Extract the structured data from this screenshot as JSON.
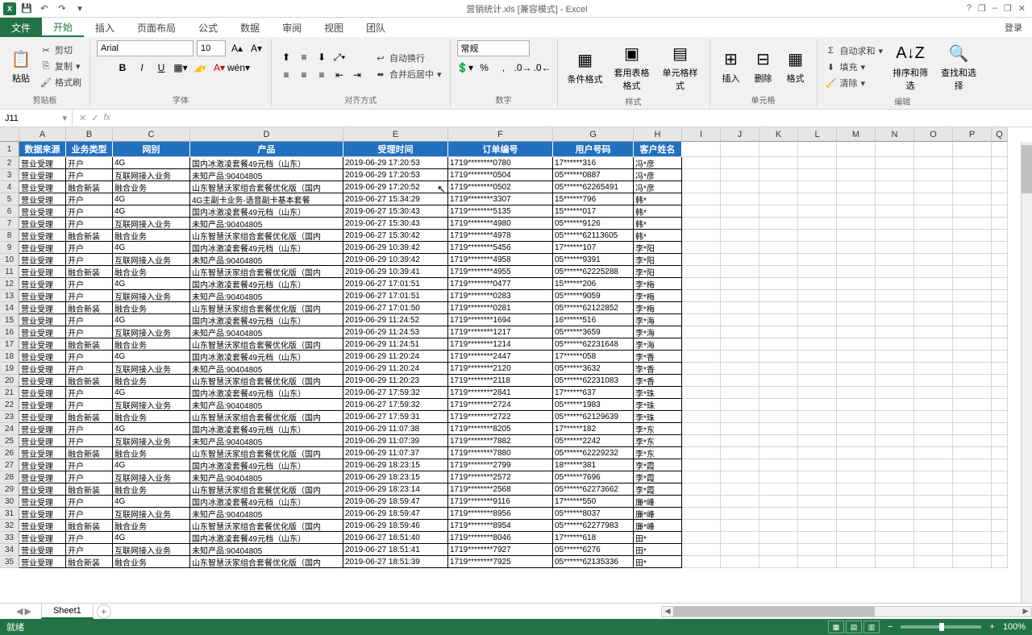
{
  "title": "营销统计.xls [兼容模式] - Excel",
  "qa": {
    "save": "💾",
    "undo": "↶",
    "redo": "↷"
  },
  "window": {
    "help": "?",
    "min": "▁",
    "restore": "❐",
    "max": "–",
    "close": "✕"
  },
  "tabs": {
    "file": "文件",
    "home": "开始",
    "insert": "插入",
    "layout": "页面布局",
    "formulas": "公式",
    "data": "数据",
    "review": "审阅",
    "view": "视图",
    "team": "团队"
  },
  "signin": "登录",
  "ribbon": {
    "clipboard": {
      "paste": "粘贴",
      "cut": "剪切",
      "copy": "复制",
      "painter": "格式刷",
      "label": "剪贴板"
    },
    "font": {
      "name": "Arial",
      "size": "10",
      "bold": "B",
      "italic": "I",
      "underline": "U",
      "label": "字体"
    },
    "align": {
      "wrap": "自动换行",
      "merge": "合并后居中",
      "label": "对齐方式"
    },
    "number": {
      "format": "常规",
      "label": "数字"
    },
    "styles": {
      "cond": "条件格式",
      "table": "套用表格格式",
      "cell": "单元格样式",
      "label": "样式"
    },
    "cells": {
      "insert": "插入",
      "delete": "删除",
      "format": "格式",
      "label": "单元格"
    },
    "editing": {
      "autosum": "自动求和",
      "fill": "填充",
      "clear": "清除",
      "sort": "排序和筛选",
      "find": "查找和选择",
      "label": "编辑"
    }
  },
  "nameBox": "J11",
  "fx": "fx",
  "columns": [
    "A",
    "B",
    "C",
    "D",
    "E",
    "F",
    "G",
    "H",
    "I",
    "J",
    "K",
    "L",
    "M",
    "N",
    "O",
    "P",
    "Q"
  ],
  "headers": [
    "数据来源",
    "业务类型",
    "网别",
    "产品",
    "受理时间",
    "订单编号",
    "用户号码",
    "客户姓名"
  ],
  "rows": [
    [
      "营业受理",
      "开户",
      "4G",
      "国内冰激凌套餐49元档（山东）",
      "2019-06-29 17:20:53",
      "1719********0780",
      "17******316",
      "冯*彦"
    ],
    [
      "营业受理",
      "开户",
      "互联网接入业务",
      "未知产品:90404805",
      "2019-06-29 17:20:53",
      "1719********0504",
      "05******0887",
      "冯*彦"
    ],
    [
      "营业受理",
      "融合新装",
      "融合业务",
      "山东智慧沃家组合套餐优化版（国内",
      "2019-06-29 17:20:52",
      "1719********0502",
      "05******62265491",
      "冯*彦"
    ],
    [
      "营业受理",
      "开户",
      "4G",
      "4G主副卡业务-语音副卡基本套餐",
      "2019-06-27 15:34:29",
      "1719********3307",
      "15******796",
      "韩*"
    ],
    [
      "营业受理",
      "开户",
      "4G",
      "国内冰激凌套餐49元档（山东）",
      "2019-06-27 15:30:43",
      "1719********5135",
      "15******017",
      "韩*"
    ],
    [
      "营业受理",
      "开户",
      "互联网接入业务",
      "未知产品:90404805",
      "2019-06-27 15:30:43",
      "1719********4980",
      "05******9126",
      "韩*"
    ],
    [
      "营业受理",
      "融合新装",
      "融合业务",
      "山东智慧沃家组合套餐优化版（国内",
      "2019-06-27 15:30:42",
      "1719********4978",
      "05******62113605",
      "韩*"
    ],
    [
      "营业受理",
      "开户",
      "4G",
      "国内冰激凌套餐49元档（山东）",
      "2019-06-29 10:39:42",
      "1719********5456",
      "17******107",
      "李*阳"
    ],
    [
      "营业受理",
      "开户",
      "互联网接入业务",
      "未知产品:90404805",
      "2019-06-29 10:39:42",
      "1719********4958",
      "05******9391",
      "李*阳"
    ],
    [
      "营业受理",
      "融合新装",
      "融合业务",
      "山东智慧沃家组合套餐优化版（国内",
      "2019-06-29 10:39:41",
      "1719********4955",
      "05******62225288",
      "李*阳"
    ],
    [
      "营业受理",
      "开户",
      "4G",
      "国内冰激凌套餐49元档（山东）",
      "2019-06-27 17:01:51",
      "1719********0477",
      "15******206",
      "李*梅"
    ],
    [
      "营业受理",
      "开户",
      "互联网接入业务",
      "未知产品:90404805",
      "2019-06-27 17:01:51",
      "1719********0283",
      "05******9059",
      "李*梅"
    ],
    [
      "营业受理",
      "融合新装",
      "融合业务",
      "山东智慧沃家组合套餐优化版（国内",
      "2019-06-27 17:01:50",
      "1719********0281",
      "05******62122852",
      "李*梅"
    ],
    [
      "营业受理",
      "开户",
      "4G",
      "国内冰激凌套餐49元档（山东）",
      "2019-06-29 11:24:52",
      "1719********1694",
      "16******516",
      "李*海"
    ],
    [
      "营业受理",
      "开户",
      "互联网接入业务",
      "未知产品:90404805",
      "2019-06-29 11:24:53",
      "1719********1217",
      "05******3659",
      "李*海"
    ],
    [
      "营业受理",
      "融合新装",
      "融合业务",
      "山东智慧沃家组合套餐优化版（国内",
      "2019-06-29 11:24:51",
      "1719********1214",
      "05******62231648",
      "李*海"
    ],
    [
      "营业受理",
      "开户",
      "4G",
      "国内冰激凌套餐49元档（山东）",
      "2019-06-29 11:20:24",
      "1719********2447",
      "17******058",
      "李*香"
    ],
    [
      "营业受理",
      "开户",
      "互联网接入业务",
      "未知产品:90404805",
      "2019-06-29 11:20:24",
      "1719********2120",
      "05******3632",
      "李*香"
    ],
    [
      "营业受理",
      "融合新装",
      "融合业务",
      "山东智慧沃家组合套餐优化版（国内",
      "2019-06-29 11:20:23",
      "1719********2118",
      "05******62231083",
      "李*香"
    ],
    [
      "营业受理",
      "开户",
      "4G",
      "国内冰激凌套餐49元档（山东）",
      "2019-06-27 17:59:32",
      "1719********2841",
      "17******637",
      "李*珠"
    ],
    [
      "营业受理",
      "开户",
      "互联网接入业务",
      "未知产品:90404805",
      "2019-06-27 17:59:32",
      "1719********2724",
      "05******1983",
      "李*珠"
    ],
    [
      "营业受理",
      "融合新装",
      "融合业务",
      "山东智慧沃家组合套餐优化版（国内",
      "2019-06-27 17:59:31",
      "1719********2722",
      "05******62129639",
      "李*珠"
    ],
    [
      "营业受理",
      "开户",
      "4G",
      "国内冰激凌套餐49元档（山东）",
      "2019-06-29 11:07:38",
      "1719********8205",
      "17******182",
      "李*东"
    ],
    [
      "营业受理",
      "开户",
      "互联网接入业务",
      "未知产品:90404805",
      "2019-06-29 11:07:39",
      "1719********7882",
      "05******2242",
      "李*东"
    ],
    [
      "营业受理",
      "融合新装",
      "融合业务",
      "山东智慧沃家组合套餐优化版（国内",
      "2019-06-29 11:07:37",
      "1719********7880",
      "05******62229232",
      "李*东"
    ],
    [
      "营业受理",
      "开户",
      "4G",
      "国内冰激凌套餐49元档（山东）",
      "2019-06-29 18:23:15",
      "1719********2799",
      "18******381",
      "李*霞"
    ],
    [
      "营业受理",
      "开户",
      "互联网接入业务",
      "未知产品:90404805",
      "2019-06-29 18:23:15",
      "1719********2572",
      "05******7696",
      "李*霞"
    ],
    [
      "营业受理",
      "融合新装",
      "融合业务",
      "山东智慧沃家组合套餐优化版（国内",
      "2019-06-29 18:23:14",
      "1719********2568",
      "05******62273662",
      "李*霞"
    ],
    [
      "营业受理",
      "开户",
      "4G",
      "国内冰激凌套餐49元档（山东）",
      "2019-06-29 18:59:47",
      "1719********9116",
      "17******550",
      "廉*峰"
    ],
    [
      "营业受理",
      "开户",
      "互联网接入业务",
      "未知产品:90404805",
      "2019-06-29 18:59:47",
      "1719********8956",
      "05******8037",
      "廉*峰"
    ],
    [
      "营业受理",
      "融合新装",
      "融合业务",
      "山东智慧沃家组合套餐优化版（国内",
      "2019-06-29 18:59:46",
      "1719********8954",
      "05******62277983",
      "廉*峰"
    ],
    [
      "营业受理",
      "开户",
      "4G",
      "国内冰激凌套餐49元档（山东）",
      "2019-06-27 18:51:40",
      "1719********8046",
      "17******618",
      "田*"
    ],
    [
      "营业受理",
      "开户",
      "互联网接入业务",
      "未知产品:90404805",
      "2019-06-27 18:51:41",
      "1719********7927",
      "05******6276",
      "田*"
    ],
    [
      "营业受理",
      "融合新装",
      "融合业务",
      "山东智慧沃家组合套餐优化版（国内",
      "2019-06-27 18:51:39",
      "1719********7925",
      "05******62135336",
      "田*"
    ]
  ],
  "sheet": {
    "name": "Sheet1",
    "add": "+"
  },
  "status": {
    "ready": "就绪",
    "zoom": "100%"
  }
}
